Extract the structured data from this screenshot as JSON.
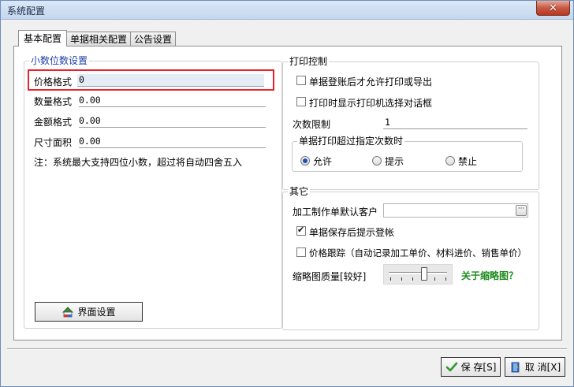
{
  "window": {
    "title": "系统配置",
    "close_label": "✕"
  },
  "tabs": [
    {
      "label": "基本配置",
      "active": true
    },
    {
      "label": "单据相关配置",
      "active": false
    },
    {
      "label": "公告设置",
      "active": false
    }
  ],
  "decimal_group": {
    "title": "小数位数设置",
    "fields": [
      {
        "label": "价格格式",
        "value": "0"
      },
      {
        "label": "数量格式",
        "value": "0.00"
      },
      {
        "label": "金额格式",
        "value": "0.00"
      },
      {
        "label": "尺寸面积",
        "value": "0.00"
      }
    ],
    "note": "注：系统最大支持四位小数，超过将自动四舍五入"
  },
  "ui_settings_button": {
    "label": "界面设置"
  },
  "print_group": {
    "title": "打印控制",
    "opt_after_post": {
      "label": "单据登账后才允许打印或导出",
      "checked": false
    },
    "opt_show_dialog": {
      "label": "打印时显示打印机选择对话框",
      "checked": false
    },
    "limit_label": "次数限制",
    "limit_value": "1",
    "exceed_group": {
      "title": "单据打印超过指定次数时",
      "options": [
        {
          "label": "允许",
          "checked": true
        },
        {
          "label": "提示",
          "checked": false
        },
        {
          "label": "禁止",
          "checked": false
        }
      ]
    }
  },
  "other_group": {
    "title": "其它",
    "customer_label": "加工制作单默认客户",
    "customer_value": "",
    "browse_label": "···",
    "opt_post_prompt": {
      "label": "单据保存后提示登帐",
      "checked": true
    },
    "opt_price_track": {
      "label": "价格跟踪（自动记录加工单价、材料进价、销售单价）",
      "checked": false
    },
    "thumb_label": "缩略图质量[较好]",
    "thumb_level": 0.6,
    "thumb_link": "关于缩略图？"
  },
  "footer": {
    "save_label": "保 存[S]",
    "cancel_label": "取 消[X]"
  },
  "colors": {
    "highlight": "#e8232b",
    "group_title": "#1f3ea8",
    "link": "#1e8a1e"
  }
}
